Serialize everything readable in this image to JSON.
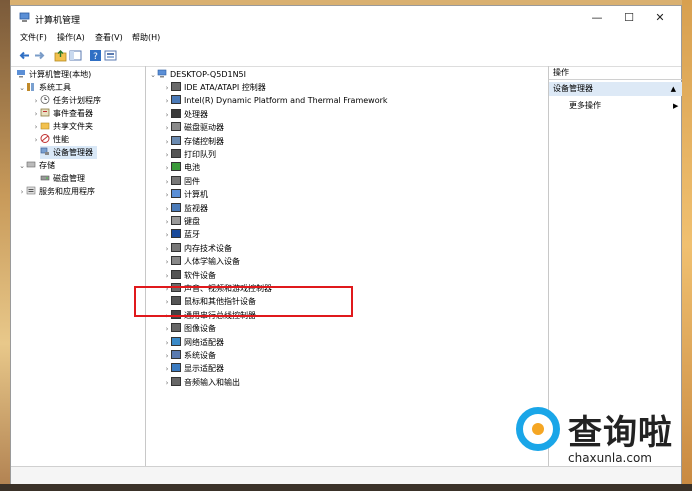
{
  "window": {
    "title": "计算机管理",
    "controls": {
      "minimize": "—",
      "maximize": "☐",
      "close": "✕"
    }
  },
  "menu": [
    "文件(F)",
    "操作(A)",
    "查看(V)",
    "帮助(H)"
  ],
  "left_tree": [
    {
      "label": "计算机管理(本地)",
      "level": 0,
      "expanded": true,
      "icon": "computer-management-icon"
    },
    {
      "label": "系统工具",
      "level": 1,
      "expanded": true,
      "icon": "tools-icon"
    },
    {
      "label": "任务计划程序",
      "level": 2,
      "expanded": false,
      "icon": "clock-icon"
    },
    {
      "label": "事件查看器",
      "level": 2,
      "expanded": false,
      "icon": "event-viewer-icon"
    },
    {
      "label": "共享文件夹",
      "level": 2,
      "expanded": false,
      "icon": "folder-icon"
    },
    {
      "label": "性能",
      "level": 2,
      "expanded": false,
      "icon": "performance-icon"
    },
    {
      "label": "设备管理器",
      "level": 2,
      "selected": true,
      "icon": "device-manager-icon"
    },
    {
      "label": "存储",
      "level": 1,
      "expanded": true,
      "icon": "storage-icon"
    },
    {
      "label": "磁盘管理",
      "level": 2,
      "icon": "disk-management-icon"
    },
    {
      "label": "服务和应用程序",
      "level": 1,
      "expanded": false,
      "icon": "services-icon"
    }
  ],
  "device_tree": {
    "root": "DESKTOP-Q5D1N5I",
    "items": [
      "IDE ATA/ATAPI 控制器",
      "Intel(R) Dynamic Platform and Thermal Framework",
      "处理器",
      "磁盘驱动器",
      "存储控制器",
      "打印队列",
      "电池",
      "固件",
      "计算机",
      "监视器",
      "键盘",
      "蓝牙",
      "内存技术设备",
      "人体学输入设备",
      "软件设备",
      "声音、视频和游戏控制器",
      "鼠标和其他指针设备",
      "通用串行总线控制器",
      "图像设备",
      "网络适配器",
      "系统设备",
      "显示适配器",
      "音频输入和输出"
    ]
  },
  "actions": {
    "header": "操作",
    "section": "设备管理器",
    "more": "更多操作"
  },
  "watermark": {
    "brand": "查询啦",
    "url": "chaxunla.com"
  },
  "colors": {
    "highlight_box": "#e0191c",
    "selection": "#d9e8f7",
    "brand_blue": "#1aa6e8",
    "brand_orange": "#f5a623"
  }
}
